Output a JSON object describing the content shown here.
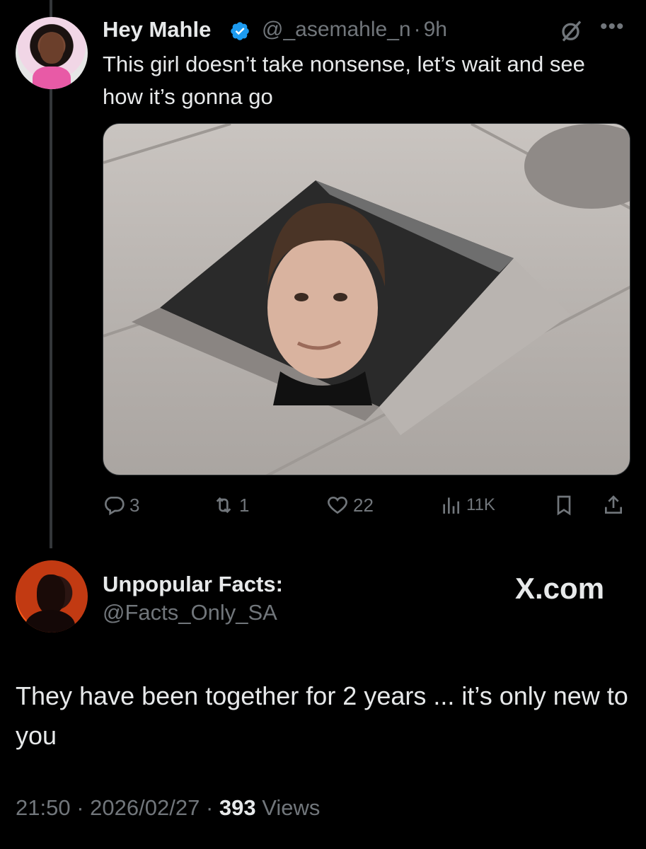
{
  "tweet1": {
    "author_name": "Hey Mahle",
    "handle": "@_asemahle_n",
    "separator": "·",
    "time": "9h",
    "text": "This girl doesn’t take nonsense, let’s wait and see how it’s gonna go",
    "media_icon": "photo",
    "stats": {
      "replies": "3",
      "reposts": "1",
      "likes": "22",
      "views": "11K"
    },
    "icons": [
      "verified-badge-icon",
      "grok-icon",
      "more-icon",
      "reply-icon",
      "repost-icon",
      "like-icon",
      "views-icon",
      "bookmark-icon",
      "share-icon"
    ]
  },
  "tweet2": {
    "author_name": "Unpopular Facts:",
    "handle": "@Facts_Only_SA",
    "site_label": "X.com",
    "text": "They have been together for 2 years ... it’s only new to you",
    "time": "21:50",
    "sep1": "·",
    "date": "2026/02/27",
    "sep2": "·",
    "views_count": "393",
    "views_label": "Views"
  },
  "colors": {
    "background": "#000000",
    "text": "#e7e9ea",
    "muted": "#71767b",
    "verified": "#1d9bf0",
    "thread_line": "#333639"
  }
}
